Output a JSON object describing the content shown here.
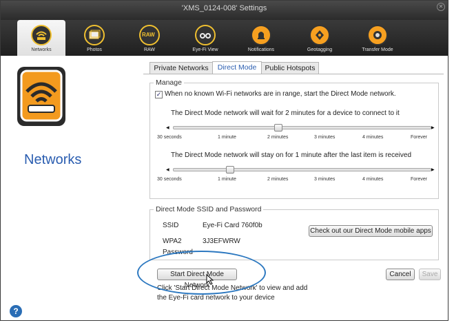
{
  "window": {
    "title": "'XMS_0124-008' Settings"
  },
  "toolbar": {
    "items": [
      {
        "label": "Networks",
        "icon": "wifi-router-icon"
      },
      {
        "label": "Photos",
        "icon": "photos-icon"
      },
      {
        "label": "RAW",
        "icon": "raw-icon"
      },
      {
        "label": "Eye-Fi View",
        "icon": "eye-fi-view-icon"
      },
      {
        "label": "Notifications",
        "icon": "bell-icon"
      },
      {
        "label": "Geotagging",
        "icon": "geotag-icon"
      },
      {
        "label": "Transfer Mode",
        "icon": "transfer-mode-icon"
      }
    ],
    "raw_badge": "RAW"
  },
  "sidebar": {
    "title": "Networks",
    "help": "?"
  },
  "tabs": [
    "Private Networks",
    "Direct Mode",
    "Public Hotspots"
  ],
  "manage": {
    "legend": "Manage",
    "checkbox_label": "When no known Wi-Fi networks are in range, start the Direct Mode network.",
    "checkbox_checked": true,
    "slider1": {
      "text": "The Direct Mode network will wait for 2 minutes for a device to connect to it",
      "ticks": [
        "30 seconds",
        "1 minute",
        "2 minutes",
        "3 minutes",
        "4 minutes",
        "Forever"
      ],
      "value": "2 minutes"
    },
    "slider2": {
      "text": "The Direct Mode network will stay on for 1 minute after the last item is received",
      "ticks": [
        "30 seconds",
        "1 minute",
        "2 minutes",
        "3 minutes",
        "4 minutes",
        "Forever"
      ],
      "value": "1 minute"
    }
  },
  "ssid": {
    "legend": "Direct Mode SSID and Password",
    "ssid_label": "SSID",
    "ssid_value": "Eye-Fi Card 760f0b",
    "wpa_label": "WPA2",
    "pwd_label": "Password",
    "wpa_value": "3J3EFWRW",
    "apps_button": "Check out our Direct Mode mobile apps"
  },
  "footer": {
    "start_button": "Start Direct Mode Network",
    "hint": "Click 'Start Direct Mode Network' to view and add the Eye-Fi card network to your device",
    "hint_line1": "Click 'Start Direct Mode Network' to view and add",
    "hint_line2": "the Eye-Fi card network to your device",
    "cancel": "Cancel",
    "save": "Save"
  },
  "colors": {
    "accent": "#2a5db0",
    "highlight_oval": "#2c78c0",
    "icon_orange": "#f7a020"
  }
}
